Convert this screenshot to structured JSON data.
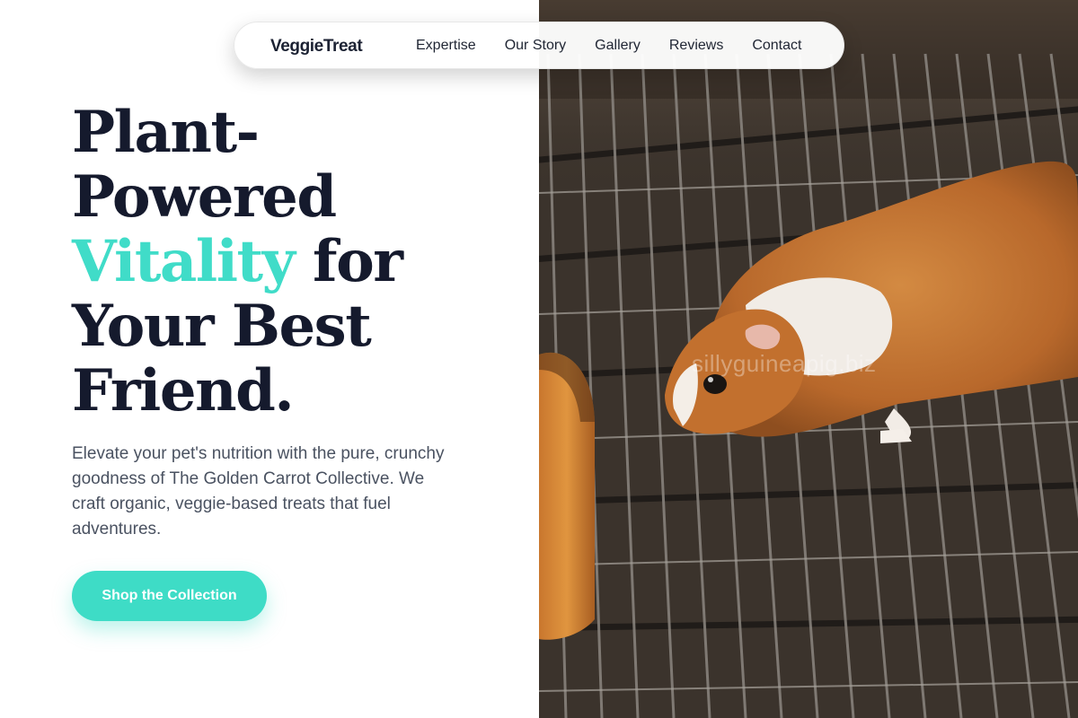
{
  "nav": {
    "brand": "VeggieTreat",
    "links": [
      "Expertise",
      "Our Story",
      "Gallery",
      "Reviews",
      "Contact"
    ]
  },
  "hero": {
    "title_line1": "Plant-",
    "title_line2": "Powered",
    "title_accent": "Vitality",
    "title_after_accent": " for",
    "title_line4": "Your Best",
    "title_line5": "Friend.",
    "description": "Elevate your pet's nutrition with the pure, crunchy goodness of The Golden Carrot Collective. We craft organic, veggie-based treats that fuel adventures.",
    "cta_label": "Shop the Collection"
  },
  "image": {
    "watermark": "sillyguineapig.biz",
    "icon": "guinea-pig-photo"
  },
  "colors": {
    "accent": "#40dcc8",
    "heading": "#151a2d",
    "body_text": "#4a5261"
  }
}
